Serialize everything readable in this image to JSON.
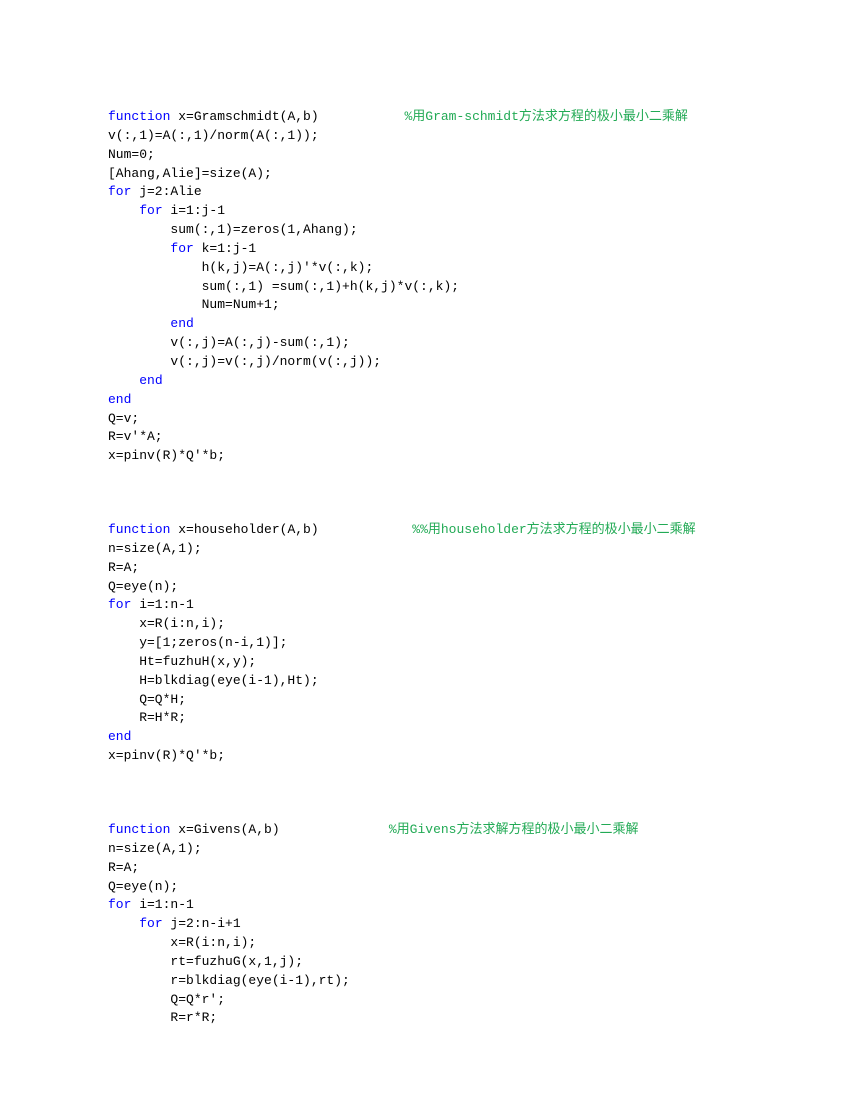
{
  "blocks": [
    {
      "lines": [
        [
          {
            "t": "kw",
            "s": "function"
          },
          {
            "t": "pl",
            "s": " x=Gramschmidt(A,b)           "
          },
          {
            "t": "cm",
            "s": "%用Gram-schmidt方法求方程的极小最小二乘解"
          }
        ],
        [
          {
            "t": "pl",
            "s": "v(:,1)=A(:,1)/norm(A(:,1));"
          }
        ],
        [
          {
            "t": "pl",
            "s": "Num=0;"
          }
        ],
        [
          {
            "t": "pl",
            "s": "[Ahang,Alie]=size(A);"
          }
        ],
        [
          {
            "t": "kw",
            "s": "for"
          },
          {
            "t": "pl",
            "s": " j=2:Alie"
          }
        ],
        [
          {
            "t": "pl",
            "s": "    "
          },
          {
            "t": "kw",
            "s": "for"
          },
          {
            "t": "pl",
            "s": " i=1:j-1"
          }
        ],
        [
          {
            "t": "pl",
            "s": "        sum(:,1)=zeros(1,Ahang);"
          }
        ],
        [
          {
            "t": "pl",
            "s": "        "
          },
          {
            "t": "kw",
            "s": "for"
          },
          {
            "t": "pl",
            "s": " k=1:j-1"
          }
        ],
        [
          {
            "t": "pl",
            "s": "            h(k,j)=A(:,j)'*v(:,k);"
          }
        ],
        [
          {
            "t": "pl",
            "s": "            sum(:,1) =sum(:,1)+h(k,j)*v(:,k);"
          }
        ],
        [
          {
            "t": "pl",
            "s": "            Num=Num+1;"
          }
        ],
        [
          {
            "t": "pl",
            "s": "        "
          },
          {
            "t": "kw",
            "s": "end"
          }
        ],
        [
          {
            "t": "pl",
            "s": "        v(:,j)=A(:,j)-sum(:,1);"
          }
        ],
        [
          {
            "t": "pl",
            "s": "        v(:,j)=v(:,j)/norm(v(:,j));"
          }
        ],
        [
          {
            "t": "pl",
            "s": "    "
          },
          {
            "t": "kw",
            "s": "end"
          }
        ],
        [
          {
            "t": "kw",
            "s": "end"
          }
        ],
        [
          {
            "t": "pl",
            "s": "Q=v;"
          }
        ],
        [
          {
            "t": "pl",
            "s": "R=v'*A;"
          }
        ],
        [
          {
            "t": "pl",
            "s": "x=pinv(R)*Q'*b;"
          }
        ]
      ]
    },
    {
      "lines": [
        [
          {
            "t": "kw",
            "s": "function"
          },
          {
            "t": "pl",
            "s": " x=householder(A,b)            "
          },
          {
            "t": "cm",
            "s": "%%用householder方法求方程的极小最小二乘解"
          }
        ],
        [
          {
            "t": "pl",
            "s": "n=size(A,1);"
          }
        ],
        [
          {
            "t": "pl",
            "s": "R=A;"
          }
        ],
        [
          {
            "t": "pl",
            "s": "Q=eye(n);"
          }
        ],
        [
          {
            "t": "kw",
            "s": "for"
          },
          {
            "t": "pl",
            "s": " i=1:n-1"
          }
        ],
        [
          {
            "t": "pl",
            "s": "    x=R(i:n,i);"
          }
        ],
        [
          {
            "t": "pl",
            "s": "    y=[1;zeros(n-i,1)];"
          }
        ],
        [
          {
            "t": "pl",
            "s": "    Ht=fuzhuH(x,y);"
          }
        ],
        [
          {
            "t": "pl",
            "s": "    H=blkdiag(eye(i-1),Ht);"
          }
        ],
        [
          {
            "t": "pl",
            "s": "    Q=Q*H;"
          }
        ],
        [
          {
            "t": "pl",
            "s": "    R=H*R;"
          }
        ],
        [
          {
            "t": "kw",
            "s": "end"
          }
        ],
        [
          {
            "t": "pl",
            "s": "x=pinv(R)*Q'*b;"
          }
        ]
      ]
    },
    {
      "lines": [
        [
          {
            "t": "kw",
            "s": "function"
          },
          {
            "t": "pl",
            "s": " x=Givens(A,b)              "
          },
          {
            "t": "cm",
            "s": "%用Givens方法求解方程的极小最小二乘解"
          }
        ],
        [
          {
            "t": "pl",
            "s": "n=size(A,1);"
          }
        ],
        [
          {
            "t": "pl",
            "s": "R=A;"
          }
        ],
        [
          {
            "t": "pl",
            "s": "Q=eye(n);"
          }
        ],
        [
          {
            "t": "kw",
            "s": "for"
          },
          {
            "t": "pl",
            "s": " i=1:n-1"
          }
        ],
        [
          {
            "t": "pl",
            "s": "    "
          },
          {
            "t": "kw",
            "s": "for"
          },
          {
            "t": "pl",
            "s": " j=2:n-i+1"
          }
        ],
        [
          {
            "t": "pl",
            "s": "        x=R(i:n,i);"
          }
        ],
        [
          {
            "t": "pl",
            "s": "        rt=fuzhuG(x,1,j);"
          }
        ],
        [
          {
            "t": "pl",
            "s": "        r=blkdiag(eye(i-1),rt);"
          }
        ],
        [
          {
            "t": "pl",
            "s": "        Q=Q*r';"
          }
        ],
        [
          {
            "t": "pl",
            "s": "        R=r*R;"
          }
        ]
      ]
    }
  ]
}
